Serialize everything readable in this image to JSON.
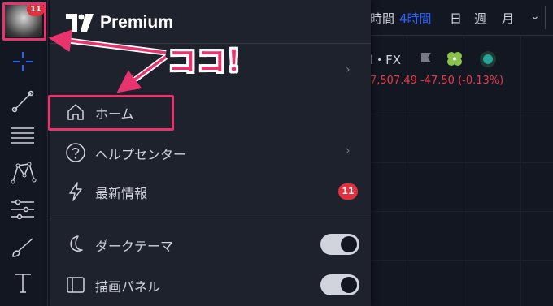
{
  "topbar": {
    "timeframes": [
      "時間",
      "4時間",
      "日",
      "週",
      "月"
    ],
    "active_timeframe": "4時間"
  },
  "chart": {
    "symbol": "l・FX",
    "price_line": "7,507.49 -47.50 (-0.13%)"
  },
  "toolbar": {
    "avatar_badge": "11",
    "tools": [
      "crosshair-icon",
      "trend-line-icon",
      "fib-icon",
      "pattern-icon",
      "forecast-icon",
      "brush-icon",
      "text-icon"
    ]
  },
  "menu": {
    "brand": "Premium",
    "home_label": "ホーム",
    "help_label": "ヘルプセンター",
    "news_label": "最新情報",
    "news_badge": "11",
    "dark_theme_label": "ダークテーマ",
    "drawing_panel_label": "描画パネル",
    "dark_theme_on": true,
    "drawing_panel_on": true
  },
  "annotation": {
    "callout_text": "ココ！"
  },
  "colors": {
    "accent": "#2962ff",
    "annotation": "#e8336c",
    "badge": "#e0323e",
    "negative": "#f23645"
  }
}
